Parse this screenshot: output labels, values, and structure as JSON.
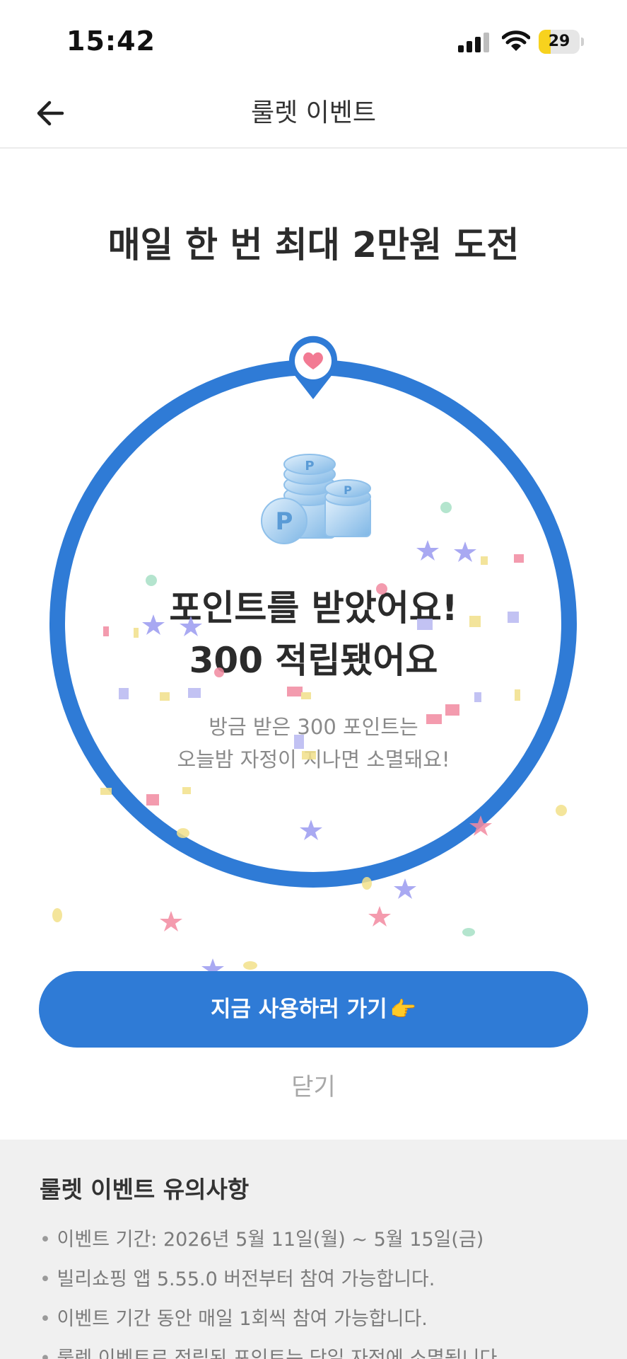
{
  "status_bar": {
    "time": "15:42",
    "battery_level": "29",
    "battery_percent": 29,
    "icons": [
      "signal-icon",
      "wifi-icon",
      "battery-icon"
    ]
  },
  "header": {
    "title": "룰렛 이벤트",
    "back_icon": "back-arrow-icon"
  },
  "headline": "매일 한 번 최대 2만원 도전",
  "roulette": {
    "ring_color": "#2f7bd6",
    "pin_icon": "heart-pin-icon",
    "coins_icon": "coins-icon",
    "result_line1": "포인트를 받았어요!",
    "result_line2": "300 적립됐어요",
    "note_line1": "방금 받은 300 포인트는",
    "note_line2": "오늘밤 자정이 지나면 소멸돼요!"
  },
  "actions": {
    "cta_label": "지금 사용하러 가기",
    "cta_emoji": "👉",
    "close_label": "닫기"
  },
  "notice": {
    "title": "룰렛 이벤트 유의사항",
    "items": [
      "이벤트 기간: 2026년 5월 11일(월) ~ 5월 15일(금)",
      "빌리쇼핑 앱 5.55.0 버전부터 참여 가능합니다.",
      "이벤트 기간 동안 매일 1회씩 참여 가능합니다.",
      "룰렛 이벤트로 적립된 포인트는 당일 자정에 소멸됩니다."
    ]
  },
  "colors": {
    "accent": "#2f7bd6",
    "heart": "#f27a93",
    "notice_bg": "#f0f0f0"
  }
}
